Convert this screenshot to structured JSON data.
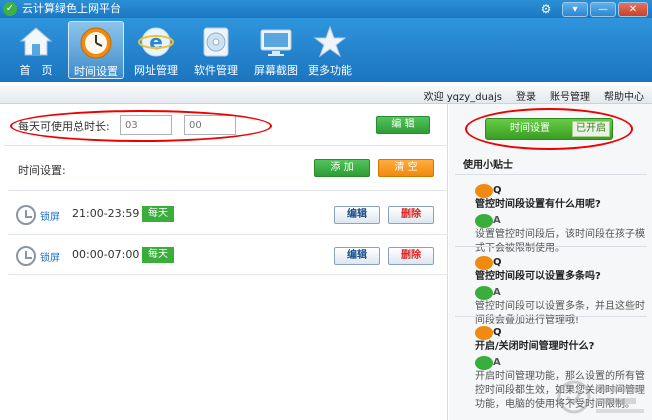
{
  "window": {
    "title": "云计算绿色上网平台",
    "buttons": {
      "menu": "▾",
      "minimize": "—",
      "close": "✕"
    }
  },
  "toolbar": {
    "items": [
      {
        "label": "首　页",
        "icon": "house-icon"
      },
      {
        "label": "时间设置",
        "icon": "clock-icon",
        "active": true
      },
      {
        "label": "网址管理",
        "icon": "browser-e-icon"
      },
      {
        "label": "软件管理",
        "icon": "disc-icon"
      },
      {
        "label": "屏幕截图",
        "icon": "monitor-icon"
      },
      {
        "label": "更多功能",
        "icon": "star-icon"
      }
    ]
  },
  "userbar": {
    "welcome": "欢迎",
    "username": "yqzy_duajs",
    "login": "登录",
    "account": "账号管理",
    "help": "帮助中心"
  },
  "daily": {
    "label": "每天可使用总时长:",
    "hours_placeholder": "03",
    "minutes_placeholder": "00",
    "edit_label": "编 辑"
  },
  "time_settings": {
    "title": "时间设置:",
    "add_label": "添 加",
    "clear_label": "清 空",
    "rows": [
      {
        "mode": "锁屏",
        "time": "21:00-23:59",
        "repeat": "每天",
        "edit": "编辑",
        "delete": "删除"
      },
      {
        "mode": "锁屏",
        "time": "00:00-07:00",
        "repeat": "每天",
        "edit": "编辑",
        "delete": "删除"
      }
    ]
  },
  "side": {
    "toggle_label": "时间设置",
    "toggle_state": "已开启",
    "tips_heading": "使用小贴士",
    "tips": [
      {
        "q": "管控时间段设置有什么用呢?",
        "a": "设置管控时间段后，该时间段在孩子模式下会被限制使用。"
      },
      {
        "q": "管控时间段可以设置多条吗?",
        "a": "管控时间段可以设置多条，并且这些时间段会叠加进行管理哦!"
      },
      {
        "q": "开启/关闭时间管理时什么?",
        "a": "开启时间管理功能，那么设置的所有管控时间段都生效，如果您关闭时间管理功能，电脑的使用将不受时间限制。"
      }
    ]
  },
  "colors": {
    "accent_blue": "#1c74bf",
    "accent_green": "#3aae3a",
    "accent_orange": "#f08a10",
    "highlight_red": "#ee0000"
  }
}
